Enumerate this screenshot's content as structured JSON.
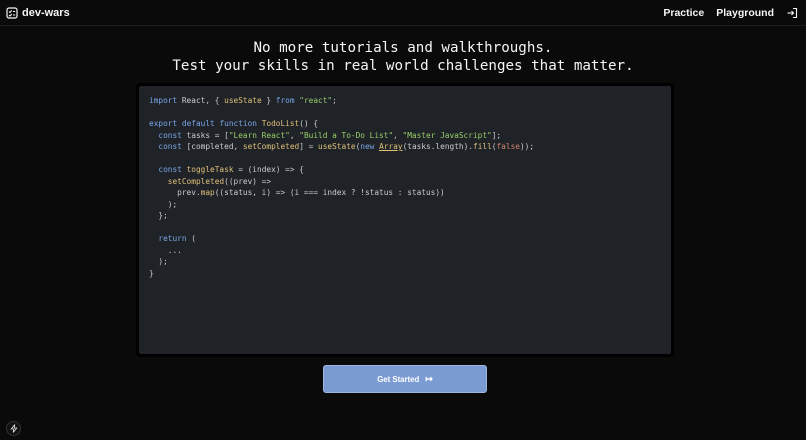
{
  "brand": {
    "name": "dev-wars",
    "icon": "todo-list-icon"
  },
  "nav": {
    "items": [
      {
        "label": "Practice"
      },
      {
        "label": "Playground"
      }
    ],
    "logout_icon": "logout-icon"
  },
  "hero": {
    "line1": "No more tutorials and walkthroughs.",
    "line2": "Test your skills in real world challenges that matter."
  },
  "code": {
    "lines": [
      "import React, { useState } from \"react\";",
      "",
      "export default function TodoList() {",
      "  const tasks = [\"Learn React\", \"Build a To-Do List\", \"Master JavaScript\"];",
      "  const [completed, setCompleted] = useState(new Array(tasks.length).fill(false));",
      "",
      "  const toggleTask = (index) => {",
      "    setCompleted((prev) =>",
      "      prev.map((status, i) => (i === index ? !status : status))",
      "    );",
      "  };",
      "",
      "  return (",
      "    ...",
      "  );",
      "}"
    ]
  },
  "cta": {
    "label": "Get Started",
    "arrow": "↦"
  },
  "colors": {
    "background": "#0a0a0a",
    "editor_bg": "#1f2227",
    "cta_bg": "#7b9bd3"
  }
}
